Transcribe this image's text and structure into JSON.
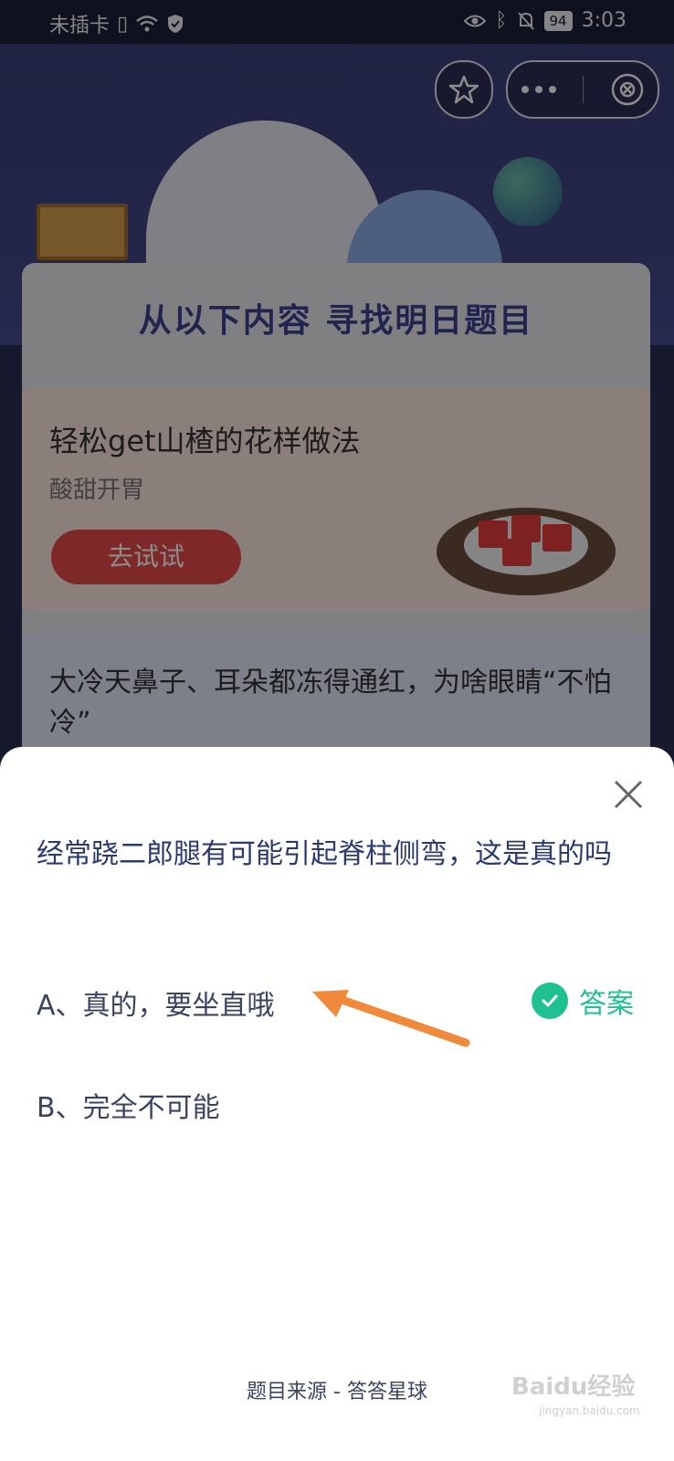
{
  "status_bar": {
    "carrier": "未插卡",
    "battery": "94",
    "time": "3:03"
  },
  "background_page": {
    "section_title": "从以下内容 寻找明日题目",
    "card1": {
      "title": "轻松get山楂的花样做法",
      "subtitle": "酸甜开胃",
      "button": "去试试"
    },
    "card2": {
      "title": "大冷天鼻子、耳朵都冻得通红，为啥眼睛“不怕冷”"
    }
  },
  "quiz_sheet": {
    "question": "经常跷二郎腿有可能引起脊柱侧弯，这是真的吗",
    "options": [
      {
        "label": "A、真的，要坐直哦",
        "is_answer": true
      },
      {
        "label": "B、完全不可能",
        "is_answer": false
      }
    ],
    "answer_tag": "答案",
    "source": "题目来源 - 答答星球"
  },
  "watermark": {
    "brand": "Baidu经验",
    "domain": "jingyan.baidu.com"
  },
  "colors": {
    "accent_green": "#1fc191",
    "arrow_orange": "#f08a3a",
    "question_text": "#2b3a6e"
  }
}
